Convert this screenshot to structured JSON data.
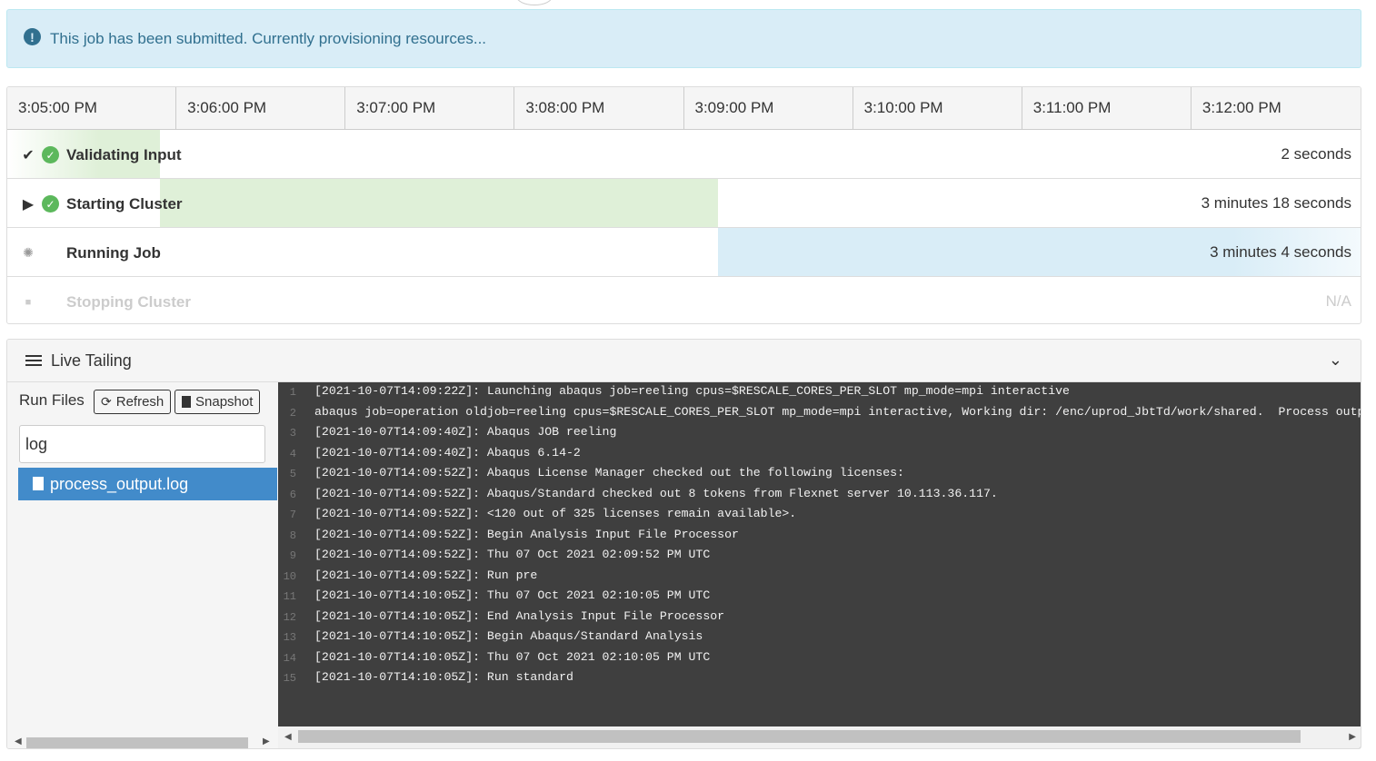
{
  "alert": {
    "text": "This job has been submitted. Currently provisioning resources...",
    "icon": "exclamation-icon"
  },
  "timeline": {
    "columns": [
      "3:05:00 PM",
      "3:06:00 PM",
      "3:07:00 PM",
      "3:08:00 PM",
      "3:09:00 PM",
      "3:10:00 PM",
      "3:11:00 PM",
      "3:12:00 PM"
    ],
    "stages": [
      {
        "name": "Validating Input",
        "duration": "2 seconds",
        "status": "complete",
        "toggle": "checkmark-icon"
      },
      {
        "name": "Starting Cluster",
        "duration": "3 minutes 18 seconds",
        "status": "complete",
        "toggle": "expand-triangle-icon"
      },
      {
        "name": "Running Job",
        "duration": "3 minutes 4 seconds",
        "status": "running",
        "toggle": "spinner-icon"
      },
      {
        "name": "Stopping Cluster",
        "duration": "N/A",
        "status": "pending",
        "toggle": "stop-square-icon"
      }
    ],
    "colors": {
      "complete": "#dff0d8",
      "running": "#d9edf7",
      "success": "#5cb85c"
    }
  },
  "panel": {
    "title": "Live Tailing",
    "files_title": "Run Files",
    "refresh_label": "Refresh",
    "snapshot_label": "Snapshot",
    "search_value": "log",
    "selected_file": "process_output.log"
  },
  "log_lines": [
    "[2021-10-07T14:09:22Z]: Launching abaqus job=reeling cpus=$RESCALE_CORES_PER_SLOT mp_mode=mpi interactive",
    "abaqus job=operation oldjob=reeling cpus=$RESCALE_CORES_PER_SLOT mp_mode=mpi interactive, Working dir: /enc/uprod_JbtTd/work/shared.  Process output fol",
    "[2021-10-07T14:09:40Z]: Abaqus JOB reeling",
    "[2021-10-07T14:09:40Z]: Abaqus 6.14-2",
    "[2021-10-07T14:09:52Z]: Abaqus License Manager checked out the following licenses:",
    "[2021-10-07T14:09:52Z]: Abaqus/Standard checked out 8 tokens from Flexnet server 10.113.36.117.",
    "[2021-10-07T14:09:52Z]: <120 out of 325 licenses remain available>.",
    "[2021-10-07T14:09:52Z]: Begin Analysis Input File Processor",
    "[2021-10-07T14:09:52Z]: Thu 07 Oct 2021 02:09:52 PM UTC",
    "[2021-10-07T14:09:52Z]: Run pre",
    "[2021-10-07T14:10:05Z]: Thu 07 Oct 2021 02:10:05 PM UTC",
    "[2021-10-07T14:10:05Z]: End Analysis Input File Processor",
    "[2021-10-07T14:10:05Z]: Begin Abaqus/Standard Analysis",
    "[2021-10-07T14:10:05Z]: Thu 07 Oct 2021 02:10:05 PM UTC",
    "[2021-10-07T14:10:05Z]: Run standard"
  ]
}
